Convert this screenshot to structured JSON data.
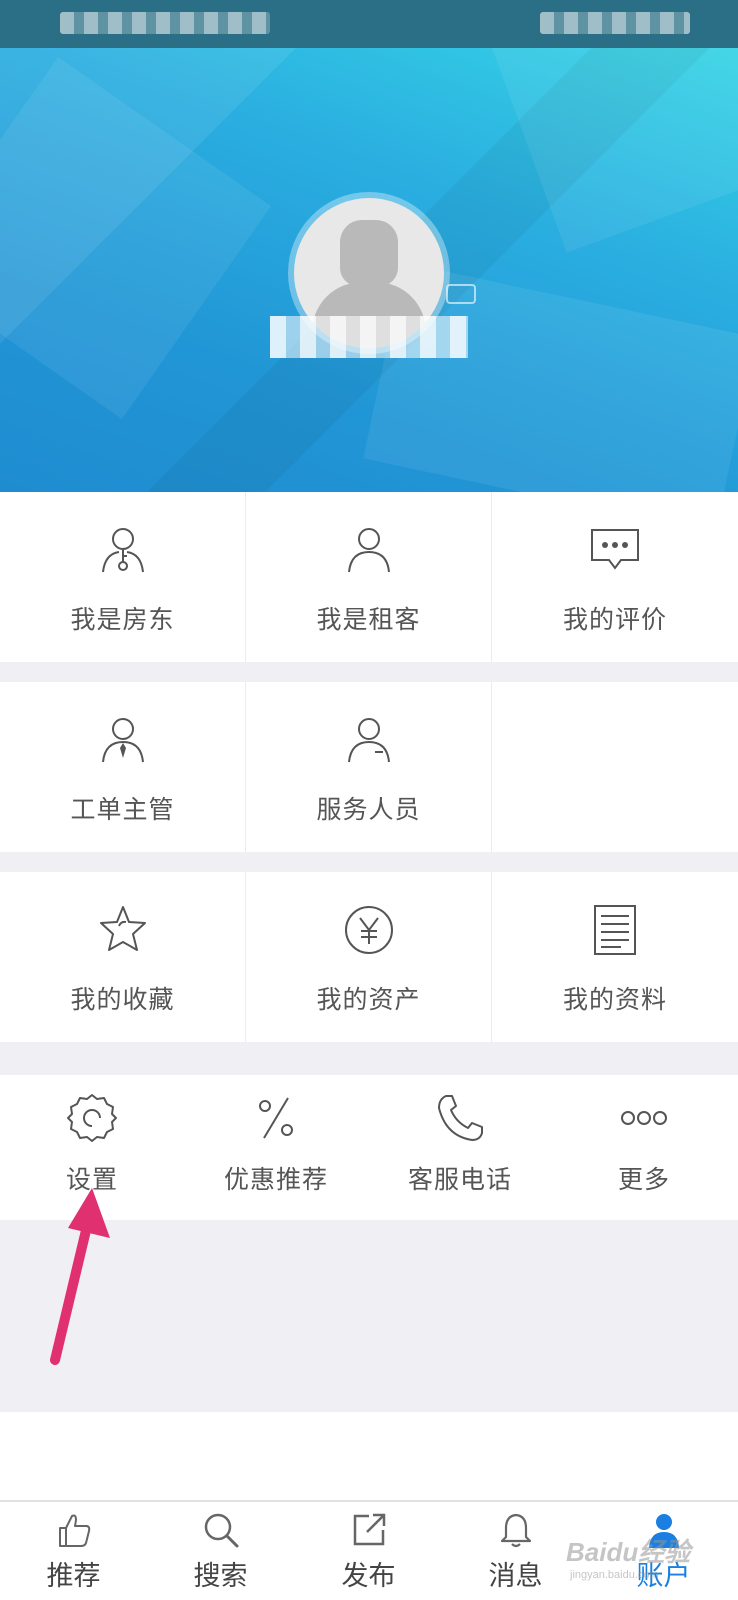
{
  "grid": {
    "row1": [
      "我是房东",
      "我是租客",
      "我的评价"
    ],
    "row2": [
      "工单主管",
      "服务人员"
    ],
    "row3": [
      "我的收藏",
      "我的资产",
      "我的资料"
    ]
  },
  "tools": [
    "设置",
    "优惠推荐",
    "客服电话",
    "更多"
  ],
  "nav": [
    "推荐",
    "搜索",
    "发布",
    "消息",
    "账户"
  ],
  "active_nav": "账户",
  "colors": {
    "accent": "#1a7fe0",
    "header_start": "#36d4e6",
    "header_end": "#1f8cd0",
    "arrow": "#e0306f"
  },
  "watermark": {
    "brand": "Baidu经验",
    "url": "jingyan.baidu.com"
  }
}
